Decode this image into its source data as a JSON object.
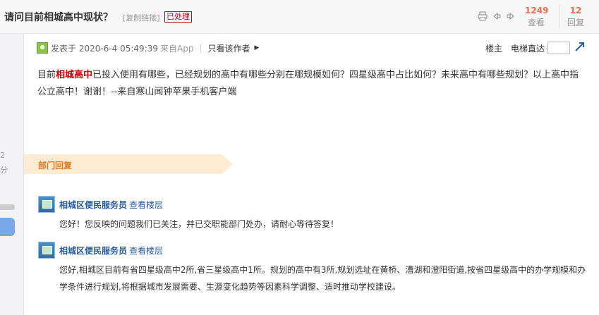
{
  "header": {
    "title": "请问目前相城高中现状？",
    "copy_link": "[复制链接]",
    "status": "已处理",
    "icons": [
      "print-icon",
      "prev-icon",
      "next-icon"
    ],
    "views": {
      "count": "1249",
      "label": "查看"
    },
    "replies": {
      "count": "12",
      "label": "回复"
    }
  },
  "sidebar": {
    "num": "2",
    "unit": "分"
  },
  "post": {
    "posted_at": "发表于 2020-6-4 05:49:39",
    "source": "来自App",
    "separator": "|",
    "author_only": "只看该作者",
    "floor": "楼主",
    "jump_label": "电梯直达",
    "body_prefix": "目前",
    "body_highlight": "相城高中",
    "body_rest": "已投入使用有哪些，已经规划的高中有哪些分别在哪规模如何？四星级高中占比如何？未来高中有哪些规划？以上高中指公立高中！谢谢！--来自寒山闻钟苹果手机客户端"
  },
  "department": {
    "label": "部门回复"
  },
  "replies": [
    {
      "author": "相城区便民服务员",
      "view_floor": "查看楼层",
      "content": "您好！您反映的问题我们已关注，并已交职能部门处办，请耐心等待答复！"
    },
    {
      "author": "相城区便民服务员",
      "view_floor": "查看楼层",
      "content": "您好,相城区目前有省四星级高中2所,省三星级高中1所。规划的高中有3所,规划选址在黄桥、漕湖和澄阳街道,按省四星级高中的办学规模和办学条件进行规划,将根据城市发展需要、生源变化趋势等因素科学调整、适时推动学校建设。"
    }
  ],
  "colors": {
    "accent": "#f26c4f",
    "link": "#2a5b9c",
    "highlight": "#cc0000",
    "banner": "#fdebd3",
    "banner_text": "#e07a1f"
  }
}
